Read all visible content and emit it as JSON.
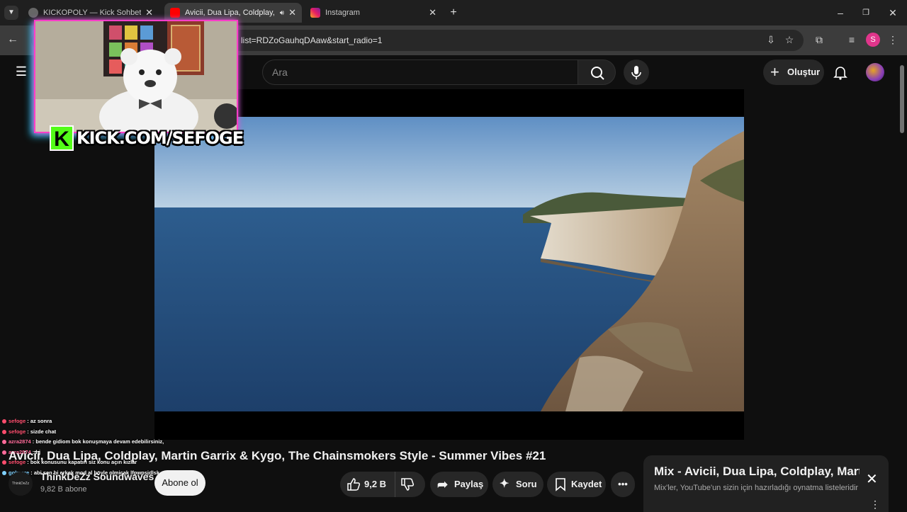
{
  "browser": {
    "tabs": [
      {
        "title": "KICKOPOLY — Kick Sohbet Mo",
        "icon": "globe-icon",
        "active": false
      },
      {
        "title": "Avicii, Dua Lipa, Coldplay, M",
        "icon": "youtube-icon",
        "active": true
      },
      {
        "title": "Instagram",
        "icon": "instagram-icon",
        "active": false
      }
    ],
    "url": "list=RDZoGauhqDAaw&start_radio=1",
    "new_tab_glyph": "+",
    "profile_initial": "S"
  },
  "youtube": {
    "search": {
      "placeholder": "Ara"
    },
    "create_label": "Oluştur"
  },
  "video": {
    "title": "Avicii, Dua Lipa, Coldplay, Martin Garrix & Kygo, The Chainsmokers Style - Summer Vibes #21",
    "channel": {
      "name": "ThinkDeZz Soundwaves",
      "subscribers": "9,82 B abone",
      "avatar_text": "ThinkDeZz"
    },
    "subscribe_label": "Abone ol",
    "like_count": "9,2 B",
    "share_label": "Paylaş",
    "ask_label": "Soru",
    "save_label": "Kaydet"
  },
  "mix": {
    "title": "Mix - Avicii, Dua Lipa, Coldplay, Mart...",
    "subtitle": "Mix'ler, YouTube'un sizin için hazırladığı oynatma listeleridir"
  },
  "stream": {
    "kick_letter": "K",
    "kick_url": "KICK.COM/SEFOGE",
    "chat": [
      {
        "user": "sefoge",
        "message": " : az sonra",
        "color": "#ff4d6d"
      },
      {
        "user": "sefoge",
        "message": " : sizde chat",
        "color": "#ff4d6d"
      },
      {
        "user": "azra2874",
        "message": " : bende gidiom bok konuşmaya devam edebilirsiniz,",
        "color": "#ff6b9a"
      },
      {
        "user": "azra2874",
        "message": " : hj",
        "color": "#ff6b9a"
      },
      {
        "user": "sefoge",
        "message": " : bok konusunu kapatırı siz konu açın kızlar",
        "color": "#ff4d6d"
      },
      {
        "user": "gokpare",
        "message": " : abi sen bi erkek mod al böyle olmicak lfpwpsjdlsk",
        "color": "#7fd1ff"
      }
    ]
  },
  "colors": {
    "kick_green": "#53fc18",
    "neon_pink": "#ff3ec8",
    "neon_blue": "#21d4ff",
    "yt_bg": "#0f0f0f"
  }
}
